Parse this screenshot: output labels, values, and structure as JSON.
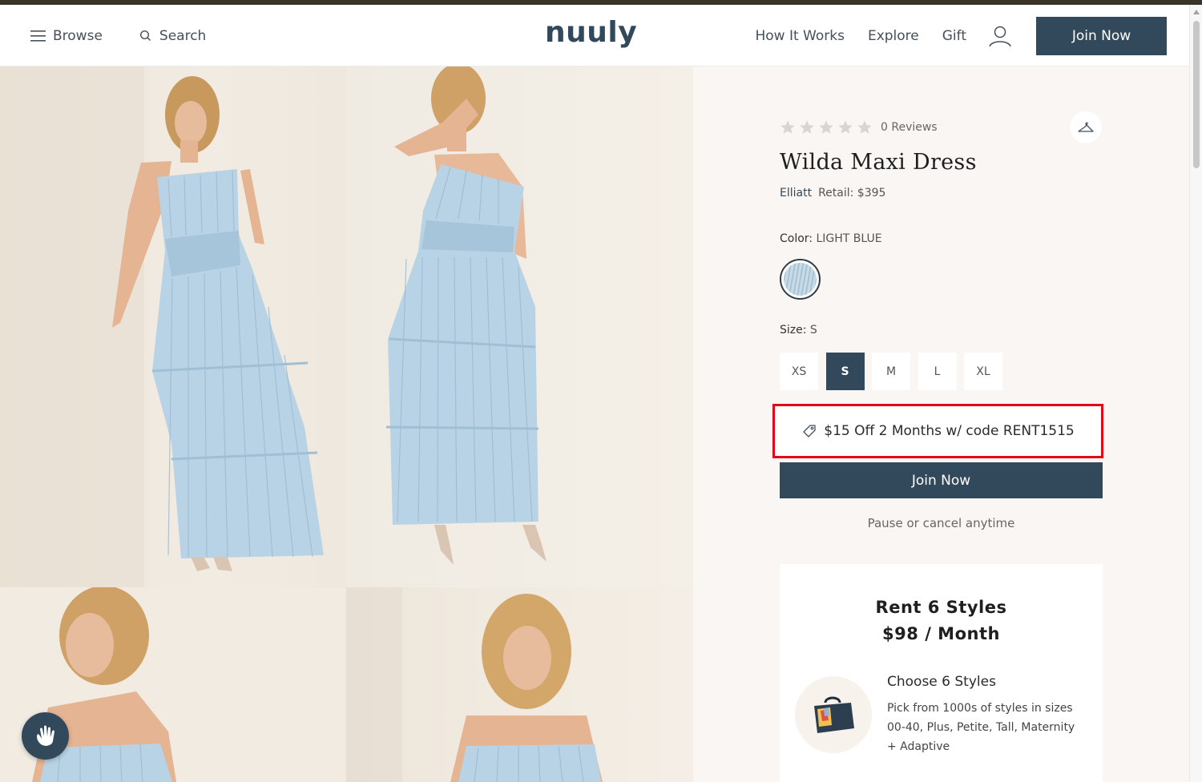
{
  "header": {
    "browse_label": "Browse",
    "search_label": "Search",
    "logo": "nuuly",
    "nav": [
      "How It Works",
      "Explore",
      "Gift"
    ],
    "join_label": "Join Now"
  },
  "product": {
    "rating": 0,
    "reviews_label": "0 Reviews",
    "title": "Wilda Maxi Dress",
    "brand": "Elliatt",
    "retail_label": "Retail: $395",
    "color_label": "Color:",
    "color_value": "LIGHT BLUE",
    "size_label": "Size:",
    "size_value": "S",
    "sizes": [
      "XS",
      "S",
      "M",
      "L",
      "XL"
    ],
    "selected_size": "S",
    "promo_text": "$15 Off 2 Months w/ code RENT1515",
    "join_label": "Join Now",
    "pause_text": "Pause or cancel anytime"
  },
  "plan": {
    "title_line1": "Rent 6 Styles",
    "title_line2": "$98 / Month",
    "step_title": "Choose 6 Styles",
    "step_desc": "Pick from 1000s of styles in sizes 00-40, Plus, Petite, Tall, Maternity + Adaptive"
  },
  "colors": {
    "brand_navy": "#32495c",
    "promo_border": "#e3061b",
    "panel_bg": "#f9f6f3",
    "dress_blue": "#b9d3e6"
  }
}
